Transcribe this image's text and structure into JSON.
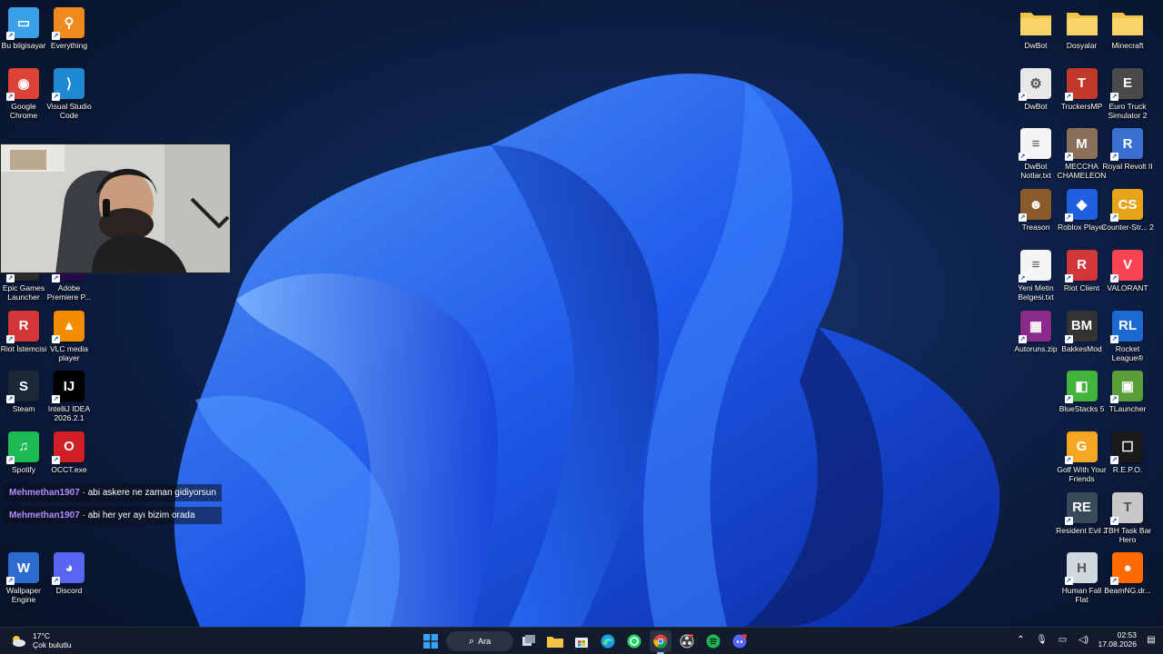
{
  "desktop": {
    "left_icons": [
      {
        "id": "bu-bilgisayar",
        "label": "Bu bilgisayar",
        "glyph": "▭",
        "color": "#3aa0e8"
      },
      {
        "id": "everything",
        "label": "Everything",
        "glyph": "⚲",
        "color": "#f08a1c"
      },
      {
        "id": "google-chrome",
        "label": "Google Chrome",
        "glyph": "◉",
        "color": "#db4437"
      },
      {
        "id": "visual-studio-code",
        "label": "Visual Studio Code",
        "glyph": "⟩",
        "color": "#1f8ad2"
      },
      {
        "id": "epic-games",
        "label": "Epic Games Launcher",
        "glyph": "E",
        "color": "#2b2b2b"
      },
      {
        "id": "adobe-premiere",
        "label": "Adobe Premiere P...",
        "glyph": "Pr",
        "color": "#2a0a4a"
      },
      {
        "id": "riot-istemcisi",
        "label": "Riot İstemcisi",
        "glyph": "R",
        "color": "#d13639"
      },
      {
        "id": "vlc",
        "label": "VLC media player",
        "glyph": "▲",
        "color": "#f28c00"
      },
      {
        "id": "steam",
        "label": "Steam",
        "glyph": "S",
        "color": "#1b2838"
      },
      {
        "id": "intellij",
        "label": "IntelliJ IDEA 2026.2.1",
        "glyph": "IJ",
        "color": "#000000"
      },
      {
        "id": "spotify",
        "label": "Spotify",
        "glyph": "♫",
        "color": "#1db954"
      },
      {
        "id": "occt",
        "label": "OCCT.exe",
        "glyph": "O",
        "color": "#d01f26"
      },
      {
        "id": "wallpaper-engine",
        "label": "Wallpaper Engine",
        "glyph": "W",
        "color": "#2e6bd1"
      },
      {
        "id": "discord",
        "label": "Discord",
        "glyph": "◕",
        "color": "#5865f2"
      }
    ],
    "right_icons": [
      {
        "id": "dwbot-folder",
        "label": "DwBot",
        "glyph": "",
        "color": "#f3c443",
        "folder": true
      },
      {
        "id": "dosyalar-folder",
        "label": "Dosyalar",
        "glyph": "",
        "color": "#f3c443",
        "folder": true
      },
      {
        "id": "minecraft-folder",
        "label": "Minecraft",
        "glyph": "",
        "color": "#f3c443",
        "folder": true
      },
      {
        "id": "dwbot-exe",
        "label": "DwBot",
        "glyph": "⚙",
        "color": "#e8e8e8"
      },
      {
        "id": "truckersmp",
        "label": "TruckersMP",
        "glyph": "T",
        "color": "#c0392b"
      },
      {
        "id": "euro-truck",
        "label": "Euro Truck Simulator 2",
        "glyph": "E",
        "color": "#4a4a4a"
      },
      {
        "id": "dwbot-notlar",
        "label": "DwBot Notlar.txt",
        "glyph": "≡",
        "color": "#f5f5f5"
      },
      {
        "id": "meccha",
        "label": "MECCHA CHAMELEON",
        "glyph": "M",
        "color": "#8a6f5b"
      },
      {
        "id": "royal-revolt",
        "label": "Royal Revolt II",
        "glyph": "R",
        "color": "#3a6fd1"
      },
      {
        "id": "treason",
        "label": "Treason",
        "glyph": "☻",
        "color": "#8b5a2b"
      },
      {
        "id": "roblox",
        "label": "Roblox Player",
        "glyph": "◆",
        "color": "#1f5fe0"
      },
      {
        "id": "counter-strike",
        "label": "Counter-Str... 2",
        "glyph": "CS",
        "color": "#e7a418"
      },
      {
        "id": "yeni-metin",
        "label": "Yeni Metin Belgesi.txt",
        "glyph": "≡",
        "color": "#f5f5f5"
      },
      {
        "id": "riot-client",
        "label": "Riot Client",
        "glyph": "R",
        "color": "#d13639"
      },
      {
        "id": "valorant",
        "label": "VALORANT",
        "glyph": "V",
        "color": "#fa4454"
      },
      {
        "id": "autoruns",
        "label": "Autoruns.zip",
        "glyph": "▦",
        "color": "#8b2a8b"
      },
      {
        "id": "bakkesmod",
        "label": "BakkesMod",
        "glyph": "BM",
        "color": "#333333"
      },
      {
        "id": "rocket-league",
        "label": "Rocket League®",
        "glyph": "RL",
        "color": "#1a6ad1"
      },
      {
        "id": "bluestacks",
        "label": "BlueStacks 5",
        "glyph": "◧",
        "color": "#41b43c"
      },
      {
        "id": "tlauncher",
        "label": "TLauncher",
        "glyph": "▣",
        "color": "#5a9e3a"
      },
      {
        "id": "golf-friends",
        "label": "Golf With Your Friends",
        "glyph": "G",
        "color": "#f5a623"
      },
      {
        "id": "repo",
        "label": "R.E.P.O.",
        "glyph": "☐",
        "color": "#1a1a1a"
      },
      {
        "id": "resident-evil",
        "label": "Resident Evil 2",
        "glyph": "RE",
        "color": "#3b4a5a"
      },
      {
        "id": "tbh-taskbar",
        "label": "TBH Task Bar Hero",
        "glyph": "T",
        "color": "#c8c8c8"
      },
      {
        "id": "human-fall-flat",
        "label": "Human Fall Flat",
        "glyph": "H",
        "color": "#cfd9dd"
      },
      {
        "id": "beamng",
        "label": "BeamNG.dr...",
        "glyph": "●",
        "color": "#ff6a00"
      }
    ]
  },
  "chat": [
    {
      "user": "Mehmethan1907",
      "text": " · abi askere ne zaman gidiyorsun"
    },
    {
      "user": "Mehmethan1907",
      "text": " · abi her yer ayı bizim orada"
    }
  ],
  "taskbar": {
    "weather_temp": "17°C",
    "weather_desc": "Çok bulutlu",
    "search_label": "Ara",
    "time": "02:53",
    "date": "17.08.2026"
  },
  "colors": {
    "accent": "#2f6bff",
    "taskbar_bg": "#141c2c"
  }
}
